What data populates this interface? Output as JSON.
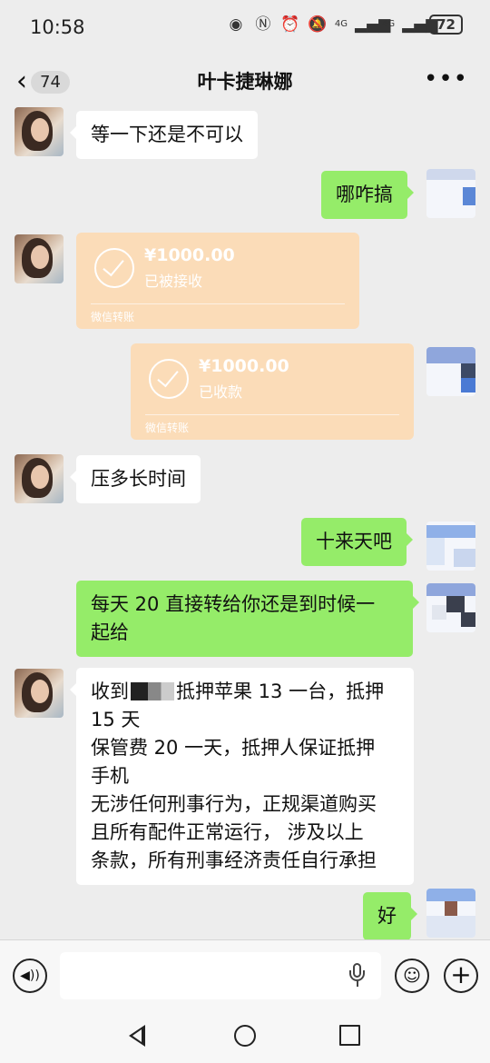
{
  "status_bar": {
    "time": "10:58",
    "network_1": "4G",
    "network_2": "4G",
    "battery": "72"
  },
  "header": {
    "unread_count": "74",
    "title": "叶卡捷琳娜",
    "more_glyph": "•••"
  },
  "messages": [
    {
      "id": "m1",
      "side": "in",
      "type": "text",
      "text": "等一下还是不可以"
    },
    {
      "id": "m2",
      "side": "out",
      "type": "text",
      "text": "哪咋搞"
    },
    {
      "id": "m3",
      "side": "in",
      "type": "transfer",
      "amount": "¥1000.00",
      "status": "已被接收",
      "label": "微信转账"
    },
    {
      "id": "m4",
      "side": "out",
      "type": "transfer",
      "amount": "¥1000.00",
      "status": "已收款",
      "label": "微信转账"
    },
    {
      "id": "m5",
      "side": "in",
      "type": "text",
      "text": "压多长时间"
    },
    {
      "id": "m6",
      "side": "out",
      "type": "text",
      "text": "十来天吧"
    },
    {
      "id": "m7",
      "side": "out",
      "type": "text",
      "lines": [
        "每天 20 直接转给你还是到时候一",
        "起给"
      ]
    },
    {
      "id": "m8",
      "side": "in",
      "type": "text",
      "line1_a": "收到",
      "line1_b": "抵押苹果 13 一台，抵押",
      "lines": [
        "15 天",
        "保管费 20 一天，抵押人保证抵押",
        "手机",
        "无涉任何刑事行为，正规渠道购买",
        "且所有配件正常运行， 涉及以上",
        "条款，所有刑事经济责任自行承担"
      ]
    },
    {
      "id": "m9",
      "side": "out",
      "type": "text",
      "text": "好"
    }
  ],
  "input": {
    "value": "",
    "placeholder": ""
  },
  "colors": {
    "background": "#ededed",
    "outgoing_bubble": "#95ec69",
    "incoming_bubble": "#ffffff",
    "transfer_card": "#fbdcb8"
  },
  "icons": [
    "eye-icon",
    "nfc-icon",
    "alarm-icon",
    "mute-icon",
    "signal-icon",
    "battery-icon",
    "back-chevron-icon",
    "more-icon",
    "check-circle-icon",
    "voice-icon",
    "microphone-icon",
    "emoji-icon",
    "plus-icon",
    "nav-back-icon",
    "nav-home-icon",
    "nav-recent-icon"
  ]
}
